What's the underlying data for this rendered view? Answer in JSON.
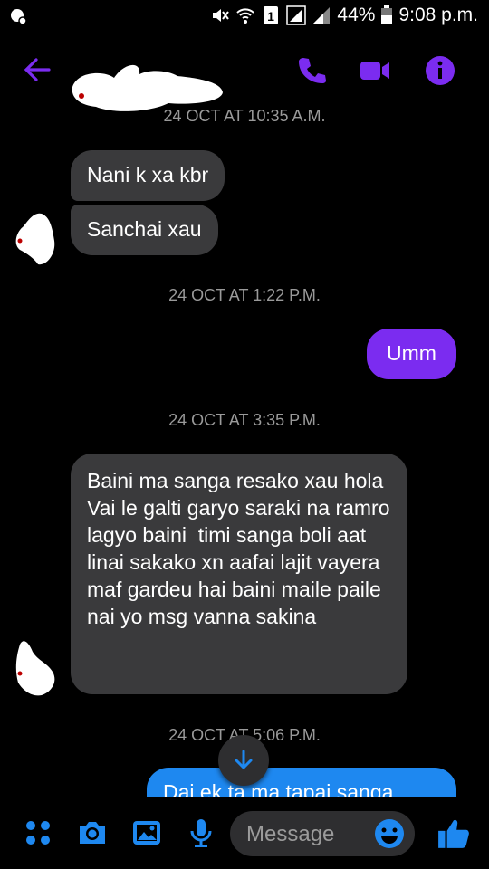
{
  "status": {
    "battery": "44%",
    "time": "9:08 p.m."
  },
  "colors": {
    "accent": "#7b2cf0",
    "blue": "#1e88f0",
    "bubble_in": "#3a3a3c",
    "bg": "#000000"
  },
  "messages": {
    "ts1": "24 OCT AT 10:35 A.M.",
    "in1": "Nani k xa kbr",
    "in2": "Sanchai xau",
    "ts2": "24 OCT AT 1:22 P.M.",
    "out1": "Umm",
    "ts3": "24 OCT AT 3:35 P.M.",
    "in3": "Baini ma sanga resako xau hola\nVai le galti garyo saraki na ramro lagyo baini  timi sanga boli aat linai sakako xn aafai lajit vayera maf gardeu hai baini maile paile nai yo msg vanna sakina",
    "ts4": "24 OCT AT 5:06 P.M.",
    "out2": "Dai ek ta ma tapai sanga"
  },
  "composer": {
    "placeholder": "Message"
  },
  "icons": [
    "back-arrow-icon",
    "phone-icon",
    "video-icon",
    "info-icon",
    "menu-dots-icon",
    "camera-icon",
    "image-icon",
    "mic-icon",
    "emoji-icon",
    "thumbs-up-icon",
    "scroll-down-icon"
  ]
}
